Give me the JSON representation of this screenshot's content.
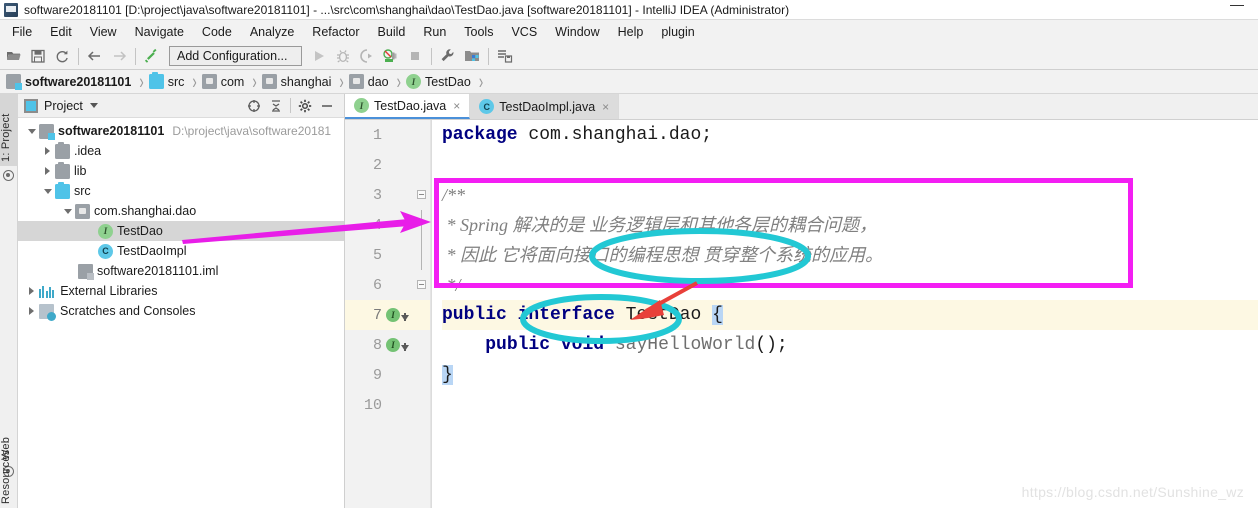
{
  "window": {
    "title": "software20181101 [D:\\project\\java\\software20181101] - ...\\src\\com\\shanghai\\dao\\TestDao.java [software20181101] - IntelliJ IDEA (Administrator)",
    "app_icon": "intellij-idea-icon",
    "minimize_label": "—"
  },
  "menubar": {
    "items": [
      {
        "label": "File"
      },
      {
        "label": "Edit"
      },
      {
        "label": "View"
      },
      {
        "label": "Navigate"
      },
      {
        "label": "Code"
      },
      {
        "label": "Analyze"
      },
      {
        "label": "Refactor"
      },
      {
        "label": "Build"
      },
      {
        "label": "Run"
      },
      {
        "label": "Tools"
      },
      {
        "label": "VCS"
      },
      {
        "label": "Window"
      },
      {
        "label": "Help"
      },
      {
        "label": "plugin"
      }
    ]
  },
  "toolbar": {
    "open_icon": "open-folder-icon",
    "save_icon": "save-icon",
    "sync_icon": "refresh-sync-icon",
    "back_icon": "arrow-left-icon",
    "forward_icon": "arrow-right-icon",
    "build_icon": "hammer-build-icon",
    "run_config_label": "Add Configuration...",
    "run_icon": "run-play-icon",
    "debug_icon": "debug-bug-icon",
    "coverage_icon": "run-coverage-icon",
    "profile_icon": "profiler-icon",
    "stop_icon": "stop-square-icon",
    "settings_icon": "wrench-settings-icon",
    "project_structure_icon": "project-structure-icon",
    "update_project_icon": "update-project-icon"
  },
  "breadcrumb": {
    "items": [
      {
        "label": "software20181101",
        "icon": "module-folder-icon"
      },
      {
        "label": "src",
        "icon": "source-folder-icon"
      },
      {
        "label": "com",
        "icon": "package-icon"
      },
      {
        "label": "shanghai",
        "icon": "package-icon"
      },
      {
        "label": "dao",
        "icon": "package-icon"
      },
      {
        "label": "TestDao",
        "icon": "interface-icon"
      }
    ],
    "separator": "›"
  },
  "left_tool_strip": {
    "items": [
      {
        "label": "1: Project",
        "icon": "project-tool-icon",
        "active": true
      },
      {
        "label": "Web",
        "icon": "web-tool-icon",
        "active": false
      },
      {
        "label": "Resources",
        "icon": "resources-tool-icon",
        "active": false
      }
    ]
  },
  "project_panel": {
    "header": {
      "title": "Project",
      "view_icon": "project-view-icon",
      "caret_icon": "chevron-down-icon",
      "locate_icon": "scroll-from-source-icon",
      "collapse_icon": "collapse-all-icon",
      "settings_icon": "gear-icon",
      "hide_icon": "hide-panel-icon"
    },
    "tree": [
      {
        "label": "software20181101",
        "path": "D:\\project\\java\\software20181",
        "icon": "module-folder-icon",
        "indent": 0,
        "twisty": "down",
        "bold": true,
        "selected": false
      },
      {
        "label": ".idea",
        "path": "",
        "icon": "folder-gray-icon",
        "indent": 1,
        "twisty": "right",
        "bold": false,
        "selected": false
      },
      {
        "label": "lib",
        "path": "",
        "icon": "folder-gray-icon",
        "indent": 1,
        "twisty": "right",
        "bold": false,
        "selected": false
      },
      {
        "label": "src",
        "path": "",
        "icon": "source-folder-icon",
        "indent": 1,
        "twisty": "down",
        "bold": false,
        "selected": false
      },
      {
        "label": "com.shanghai.dao",
        "path": "",
        "icon": "package-icon",
        "indent": 2,
        "twisty": "down",
        "bold": false,
        "selected": false
      },
      {
        "label": "TestDao",
        "path": "",
        "icon": "interface-icon",
        "indent": 3,
        "twisty": "none",
        "bold": false,
        "selected": true
      },
      {
        "label": "TestDaoImpl",
        "path": "",
        "icon": "class-icon",
        "indent": 3,
        "twisty": "none",
        "bold": false,
        "selected": false
      },
      {
        "label": "software20181101.iml",
        "path": "",
        "icon": "iml-file-icon",
        "indent": 2,
        "twisty": "none",
        "bold": false,
        "selected": false
      },
      {
        "label": "External Libraries",
        "path": "",
        "icon": "libraries-icon",
        "indent": 0,
        "twisty": "right",
        "bold": false,
        "selected": false
      },
      {
        "label": "Scratches and Consoles",
        "path": "",
        "icon": "scratches-icon",
        "indent": 0,
        "twisty": "right",
        "bold": false,
        "selected": false
      }
    ]
  },
  "editor": {
    "tabs": [
      {
        "label": "TestDao.java",
        "icon": "interface-icon",
        "active": true,
        "close": "×"
      },
      {
        "label": "TestDaoImpl.java",
        "icon": "class-icon",
        "active": false,
        "close": "×"
      }
    ],
    "line_numbers": [
      "1",
      "2",
      "3",
      "4",
      "5",
      "6",
      "7",
      "8",
      "9",
      "10"
    ],
    "current_line": 7,
    "lines": [
      {
        "n": "1",
        "segments": [
          {
            "t": "package",
            "c": "kw"
          },
          {
            "t": " com.shanghai.dao;",
            "c": "plain"
          }
        ]
      },
      {
        "n": "2",
        "segments": []
      },
      {
        "n": "3",
        "segments": [
          {
            "t": "/**",
            "c": "cmt"
          }
        ]
      },
      {
        "n": "4",
        "segments": [
          {
            "t": " * Spring 解决的是 业务逻辑层和其他各层的耦合问题，",
            "c": "cmt"
          }
        ]
      },
      {
        "n": "5",
        "segments": [
          {
            "t": " * 因此 它将面向接口的编程思想 贯穿整个系统的应用。",
            "c": "cmt"
          }
        ]
      },
      {
        "n": "6",
        "segments": [
          {
            "t": " */",
            "c": "cmt"
          }
        ]
      },
      {
        "n": "7",
        "segments": [
          {
            "t": "public",
            "c": "kw"
          },
          {
            "t": " ",
            "c": "plain"
          },
          {
            "t": "interface",
            "c": "kw"
          },
          {
            "t": " ",
            "c": "plain"
          },
          {
            "t": "TestDao",
            "c": "plain"
          },
          {
            "t": " ",
            "c": "plain"
          },
          {
            "t": "{",
            "c": "brace"
          }
        ]
      },
      {
        "n": "8",
        "segments": [
          {
            "t": "    ",
            "c": "plain"
          },
          {
            "t": "public",
            "c": "kw"
          },
          {
            "t": " ",
            "c": "plain"
          },
          {
            "t": "void",
            "c": "kw"
          },
          {
            "t": " ",
            "c": "plain"
          },
          {
            "t": "sayHelloWorld",
            "c": "gray"
          },
          {
            "t": "();",
            "c": "plain"
          }
        ]
      },
      {
        "n": "9",
        "segments": [
          {
            "t": "}",
            "c": "brace"
          }
        ]
      },
      {
        "n": "10",
        "segments": []
      }
    ],
    "gutter_markers": [
      {
        "line": 7,
        "icon": "implemented-interface-icon"
      },
      {
        "line": 8,
        "icon": "implemented-method-icon"
      }
    ]
  },
  "annotations": {
    "rect_color": "#f31ef3",
    "ellipse_color": "#22c8d4",
    "arrow_pink_color": "#e81ee8",
    "arrow_red_color": "#e8403a",
    "pink_arrow_label": "points-to-javadoc-comment",
    "red_arrow_label": "points-to-interface-keyword",
    "ellipse_top_label": "highlights-interface-oriented-programming-phrase",
    "ellipse_bottom_label": "highlights-interface-keyword"
  },
  "watermark": {
    "text": "https://blog.csdn.net/Sunshine_wz"
  }
}
